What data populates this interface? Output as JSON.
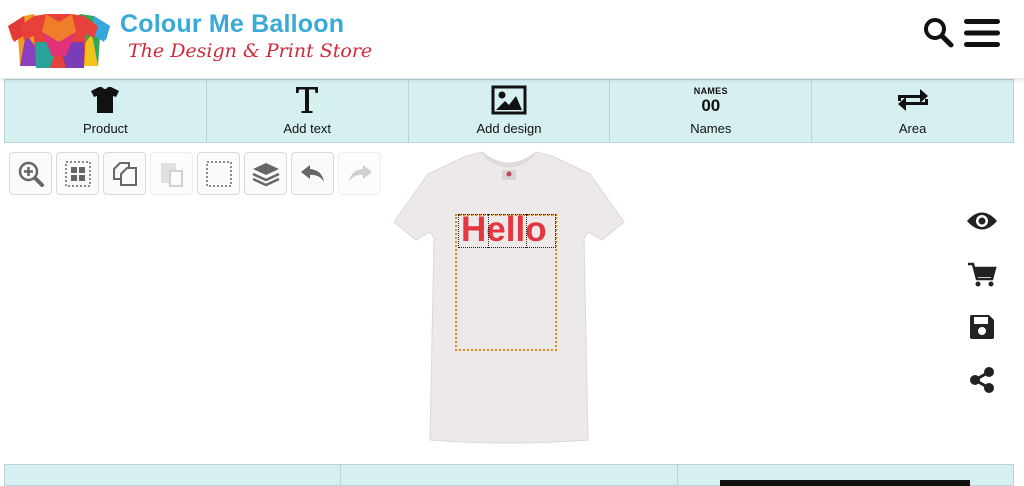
{
  "brand": {
    "name": "Colour Me Balloon",
    "tagline": "The Design & Print Store"
  },
  "header_icons": [
    "search-icon",
    "menu-icon"
  ],
  "toolbar": {
    "items": [
      {
        "label": "Product",
        "icon": "tshirt-icon"
      },
      {
        "label": "Add text",
        "icon": "text-icon"
      },
      {
        "label": "Add design",
        "icon": "image-icon"
      },
      {
        "label": "Names",
        "icon": "names-icon",
        "icon_text_top": "NAMES",
        "icon_text_bottom": "00"
      },
      {
        "label": "Area",
        "icon": "swap-arrows-icon"
      }
    ]
  },
  "mini_tools": [
    {
      "icon": "zoom-in-icon",
      "enabled": true
    },
    {
      "icon": "grid-icon",
      "enabled": true
    },
    {
      "icon": "duplicate-icon",
      "enabled": true
    },
    {
      "icon": "paste-icon",
      "enabled": false
    },
    {
      "icon": "select-box-icon",
      "enabled": true
    },
    {
      "icon": "layers-icon",
      "enabled": true
    },
    {
      "icon": "undo-icon",
      "enabled": true
    },
    {
      "icon": "redo-icon",
      "enabled": false
    }
  ],
  "canvas": {
    "text": "Hello",
    "text_color": "#e5353e",
    "shirt_color": "#ece9e8"
  },
  "side_actions": [
    "eye-icon",
    "cart-icon",
    "save-icon",
    "share-icon"
  ],
  "colors": {
    "toolbar_bg": "#d6f0f2",
    "brand_blue": "#39a9d6",
    "brand_red": "#d0293a",
    "print_area_border": "#e08a1a"
  }
}
